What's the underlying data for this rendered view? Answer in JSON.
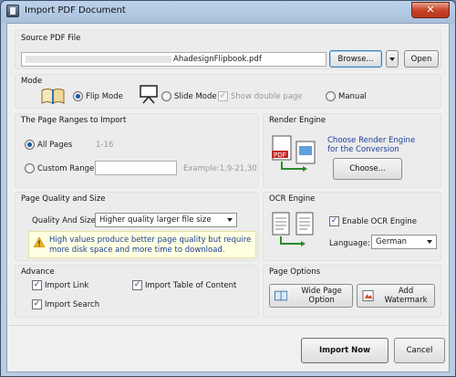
{
  "window": {
    "title": "Import PDF Document",
    "close_glyph": "✕"
  },
  "source": {
    "label": "Source PDF File",
    "path": "AhadesignFlipbook.pdf",
    "browse": "Browse...",
    "open": "Open"
  },
  "mode": {
    "label": "Mode",
    "flip": "Flip Mode",
    "slide": "Slide Mode",
    "double": "Show double page",
    "manual": "Manual"
  },
  "ranges": {
    "label": "The Page Ranges to Import",
    "all": "All Pages",
    "all_hint": "1-16",
    "custom": "Custom Range",
    "custom_value": "",
    "example": "Example:1,9-21,30"
  },
  "render": {
    "label": "Render Engine",
    "choose_text_1": "Choose Render Engine",
    "choose_text_2": "for the Conversion",
    "choose_btn": "Choose..."
  },
  "quality": {
    "label": "Page Quality and Size",
    "field_label": "Quality And Size:",
    "value": "Higher quality larger file size",
    "warning": "High values produce better page quality but require more disk space and more time to download."
  },
  "ocr": {
    "label": "OCR Engine",
    "enable": "Enable OCR Engine",
    "language_label": "Language:",
    "language": "German"
  },
  "advance": {
    "label": "Advance",
    "import_link": "Import Link",
    "import_toc": "Import Table of Content",
    "import_search": "Import Search"
  },
  "page_options": {
    "label": "Page Options",
    "wide": "Wide Page Option",
    "watermark": "Add Watermark"
  },
  "footer": {
    "import_now": "Import Now",
    "cancel": "Cancel"
  },
  "check_glyph": "✓"
}
